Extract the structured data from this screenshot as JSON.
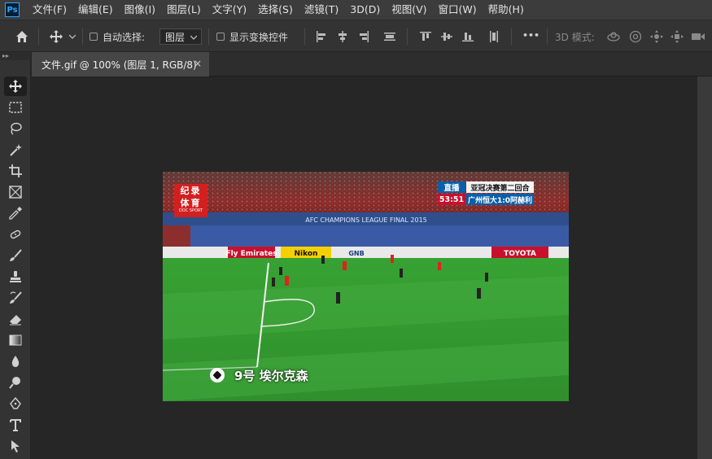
{
  "app": {
    "logo_text": "Ps"
  },
  "menu": [
    "文件(F)",
    "编辑(E)",
    "图像(I)",
    "图层(L)",
    "文字(Y)",
    "选择(S)",
    "滤镜(T)",
    "3D(D)",
    "视图(V)",
    "窗口(W)",
    "帮助(H)"
  ],
  "options_bar": {
    "auto_select_label": "自动选择:",
    "auto_select_value": "图层",
    "show_transform_label": "显示变换控件",
    "more_label": "•••",
    "mode_3d_label": "3D 模式:"
  },
  "document": {
    "tab_title": "文件.gif @ 100% (图层 1, RGB/8)",
    "close_glyph": "×"
  },
  "image": {
    "logo_top": "纪录",
    "logo_mid": "体育",
    "logo_bottom": "DOC SPORT",
    "banner_text": "AFC CHAMPIONS LEAGUE FINAL 2015",
    "scoreboard": {
      "live": "直播",
      "title": "亚冠决赛第二回合",
      "time": "53:51",
      "score": "广州恒大1:0阿赫利"
    },
    "ads": [
      "Fly Emirates",
      "Nikon",
      "GNB",
      "TOYOTA"
    ],
    "caption": "9号  埃尔克森"
  },
  "colors": {
    "pitch": "#3ea43a",
    "accent_blue": "#0a5fa8",
    "accent_red": "#c8102e",
    "app_bg": "#262626",
    "panel_bg": "#333333"
  }
}
